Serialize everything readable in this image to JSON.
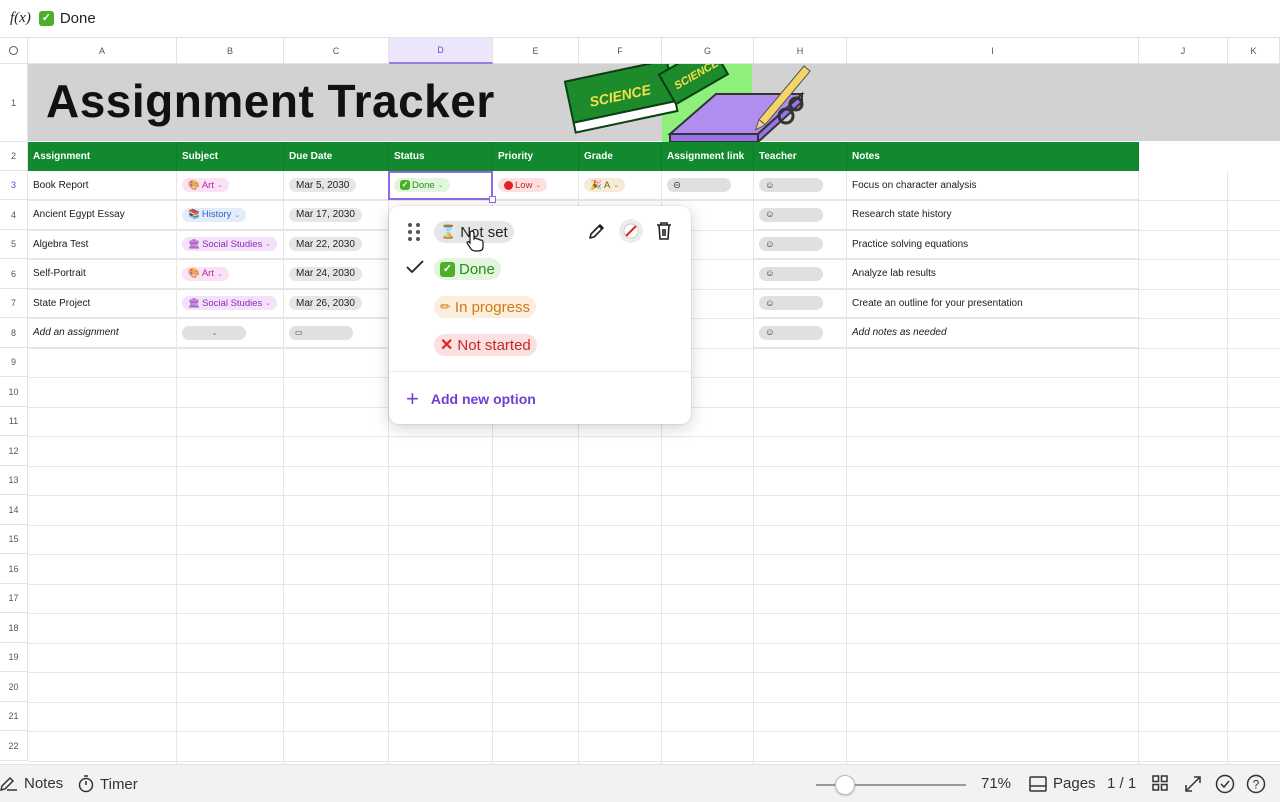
{
  "formula_bar": {
    "fx": "f(x)",
    "value": "Done"
  },
  "columns": [
    "A",
    "B",
    "C",
    "D",
    "E",
    "F",
    "G",
    "H",
    "I",
    "J",
    "K"
  ],
  "rows": [
    "1",
    "2",
    "3",
    "4",
    "5",
    "6",
    "7",
    "8",
    "9",
    "10",
    "11",
    "12",
    "13",
    "14",
    "15",
    "16",
    "17",
    "18",
    "19",
    "20",
    "21",
    "22"
  ],
  "sheet_title": "Assignment Tracker",
  "header_row": {
    "assignment": "Assignment",
    "subject": "Subject",
    "due_date": "Due Date",
    "status": "Status",
    "priority": "Priority",
    "grade": "Grade",
    "link": "Assignment link",
    "teacher": "Teacher",
    "notes": "Notes"
  },
  "assignments": [
    {
      "name": "Book Report",
      "subject": "Art",
      "due": "Mar 5, 2030",
      "status": "Done",
      "priority": "Low",
      "grade": "A",
      "notes": "Focus on character analysis"
    },
    {
      "name": "Ancient Egypt Essay",
      "subject": "History",
      "due": "Mar 17, 2030",
      "notes": "Research state history"
    },
    {
      "name": "Algebra Test",
      "subject": "Social Studies",
      "due": "Mar 22, 2030",
      "notes": "Practice solving equations"
    },
    {
      "name": "Self-Portrait",
      "subject": "Art",
      "due": "Mar 24, 2030",
      "notes": "Analyze lab results"
    },
    {
      "name": "State Project",
      "subject": "Social Studies",
      "due": "Mar 26, 2030",
      "notes": "Create an outline for your presentation"
    },
    {
      "name": "Add an assignment",
      "notes": "Add notes as needed"
    }
  ],
  "status_dropdown": {
    "options": [
      "Not set",
      "Done",
      "In progress",
      "Not started"
    ],
    "selected": "Done",
    "add_option": "Add new option"
  },
  "bottom_bar": {
    "notes": "Notes",
    "timer": "Timer",
    "zoom": "71%",
    "zoom_level": 0.71,
    "pages": "Pages",
    "page_count": "1 / 1"
  },
  "colors": {
    "header_green": "#13892f",
    "accent_purple": "#6f3fd3",
    "band_gray": "#d2d2d2"
  },
  "book_cover_text": [
    "SCIENCE",
    "SCIENCE"
  ]
}
